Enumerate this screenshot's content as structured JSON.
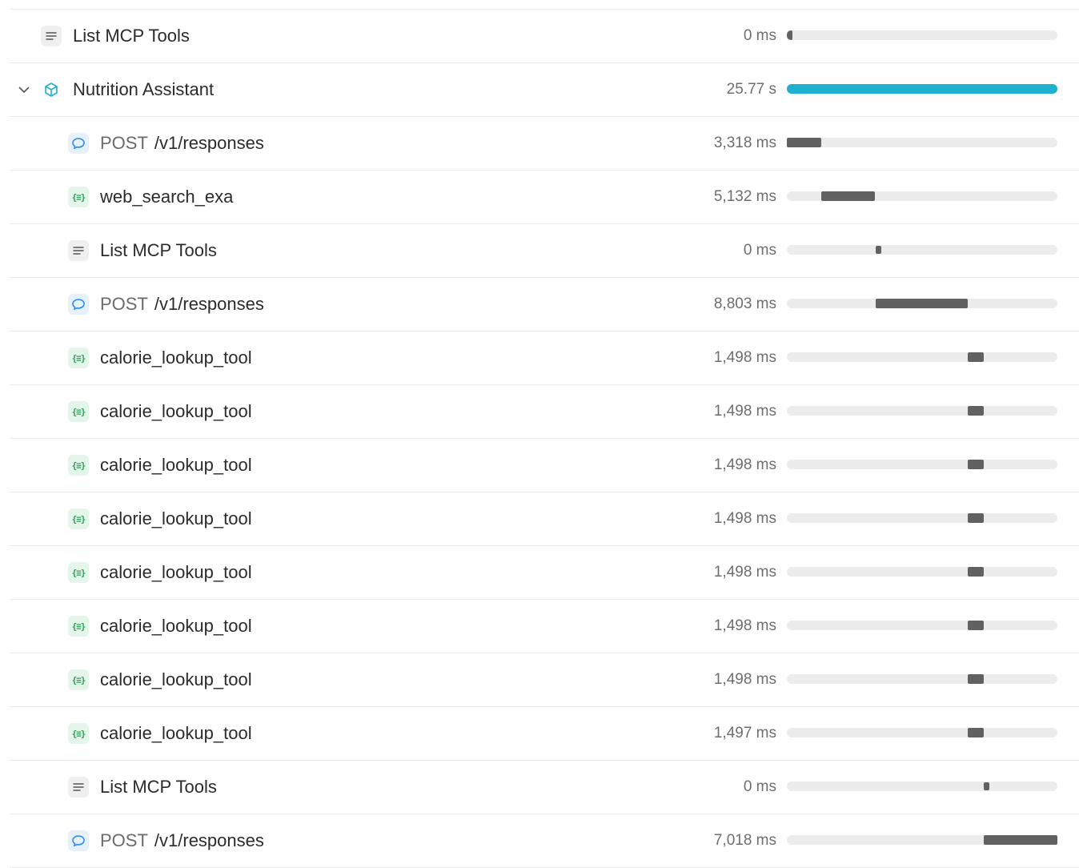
{
  "colors": {
    "bar_default": "#616161",
    "bar_agent": "#1fb0cf",
    "bar_track": "#ececec",
    "function_icon": "#2f9e5b",
    "response_icon": "#2d8ef0"
  },
  "trace": {
    "total_label": "25.77 s",
    "rows": [
      {
        "kind": "list",
        "icon": "lines-icon",
        "indent": 0,
        "method": "",
        "label": "List MCP Tools",
        "duration": "0 ms",
        "start": 0.0,
        "share": 0.0
      },
      {
        "kind": "agent",
        "icon": "cube-icon",
        "indent": 0,
        "expanded": true,
        "method": "",
        "label": "Nutrition Assistant",
        "duration": "25.77 s",
        "start": 0.0,
        "share": 1.0
      },
      {
        "kind": "chat",
        "icon": "chat-bubble-icon",
        "indent": 1,
        "method": "POST",
        "label": "/v1/responses",
        "duration": "3,318 ms",
        "start": 0.0,
        "share": 0.128
      },
      {
        "kind": "fn",
        "icon": "function-icon",
        "indent": 1,
        "method": "",
        "label": "web_search_exa",
        "duration": "5,132 ms",
        "start": 0.128,
        "share": 0.199
      },
      {
        "kind": "list",
        "icon": "lines-icon",
        "indent": 1,
        "method": "",
        "label": "List MCP Tools",
        "duration": "0 ms",
        "start": 0.328,
        "share": 0.0
      },
      {
        "kind": "chat",
        "icon": "chat-bubble-icon",
        "indent": 1,
        "method": "POST",
        "label": "/v1/responses",
        "duration": "8,803 ms",
        "start": 0.328,
        "share": 0.341
      },
      {
        "kind": "fn",
        "icon": "function-icon",
        "indent": 1,
        "method": "",
        "label": "calorie_lookup_tool",
        "duration": "1,498 ms",
        "start": 0.669,
        "share": 0.058
      },
      {
        "kind": "fn",
        "icon": "function-icon",
        "indent": 1,
        "method": "",
        "label": "calorie_lookup_tool",
        "duration": "1,498 ms",
        "start": 0.669,
        "share": 0.058
      },
      {
        "kind": "fn",
        "icon": "function-icon",
        "indent": 1,
        "method": "",
        "label": "calorie_lookup_tool",
        "duration": "1,498 ms",
        "start": 0.669,
        "share": 0.058
      },
      {
        "kind": "fn",
        "icon": "function-icon",
        "indent": 1,
        "method": "",
        "label": "calorie_lookup_tool",
        "duration": "1,498 ms",
        "start": 0.669,
        "share": 0.058
      },
      {
        "kind": "fn",
        "icon": "function-icon",
        "indent": 1,
        "method": "",
        "label": "calorie_lookup_tool",
        "duration": "1,498 ms",
        "start": 0.669,
        "share": 0.058
      },
      {
        "kind": "fn",
        "icon": "function-icon",
        "indent": 1,
        "method": "",
        "label": "calorie_lookup_tool",
        "duration": "1,498 ms",
        "start": 0.669,
        "share": 0.058
      },
      {
        "kind": "fn",
        "icon": "function-icon",
        "indent": 1,
        "method": "",
        "label": "calorie_lookup_tool",
        "duration": "1,498 ms",
        "start": 0.669,
        "share": 0.058
      },
      {
        "kind": "fn",
        "icon": "function-icon",
        "indent": 1,
        "method": "",
        "label": "calorie_lookup_tool",
        "duration": "1,497 ms",
        "start": 0.669,
        "share": 0.058
      },
      {
        "kind": "list",
        "icon": "lines-icon",
        "indent": 1,
        "method": "",
        "label": "List MCP Tools",
        "duration": "0 ms",
        "start": 0.727,
        "share": 0.0
      },
      {
        "kind": "chat",
        "icon": "chat-bubble-icon",
        "indent": 1,
        "method": "POST",
        "label": "/v1/responses",
        "duration": "7,018 ms",
        "start": 0.727,
        "share": 0.273
      }
    ]
  }
}
